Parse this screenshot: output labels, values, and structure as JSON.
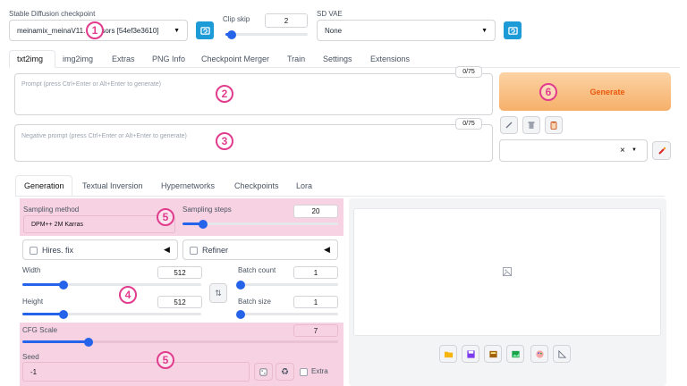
{
  "top": {
    "checkpoint_label": "Stable Diffusion checkpoint",
    "checkpoint_value": "meinamix_meinaV11.",
    "checkpoint_suffix": "sors [54ef3e3610]",
    "clip_skip_label": "Clip skip",
    "clip_skip_value": "2",
    "clip_skip_fraction": 0.08,
    "vae_label": "SD VAE",
    "vae_value": "None"
  },
  "main_tabs": [
    "txt2img",
    "img2img",
    "Extras",
    "PNG Info",
    "Checkpoint Merger",
    "Train",
    "Settings",
    "Extensions"
  ],
  "prompt": {
    "placeholder": "Prompt (press Ctrl+Enter or Alt+Enter to generate)",
    "counter": "0/75"
  },
  "negative_prompt": {
    "placeholder": "Negative prompt (press Ctrl+Enter or Alt+Enter to generate)",
    "counter": "0/75"
  },
  "generate_label": "Generate",
  "style_clear": "×",
  "sub_tabs": [
    "Generation",
    "Textual Inversion",
    "Hypernetworks",
    "Checkpoints",
    "Lora"
  ],
  "sampling": {
    "method_label": "Sampling method",
    "method_value": "DPM++ 2M Karras",
    "steps_label": "Sampling steps",
    "steps_value": "20",
    "steps_fraction": 0.13
  },
  "hires_label": "Hires. fix",
  "refiner_label": "Refiner",
  "width": {
    "label": "Width",
    "value": "512",
    "fraction": 0.23
  },
  "height": {
    "label": "Height",
    "value": "512",
    "fraction": 0.23
  },
  "batch_count": {
    "label": "Batch count",
    "value": "1",
    "fraction": 0.0
  },
  "batch_size": {
    "label": "Batch size",
    "value": "1",
    "fraction": 0.0
  },
  "cfg": {
    "label": "CFG Scale",
    "value": "7",
    "fraction": 0.21
  },
  "seed": {
    "label": "Seed",
    "value": "-1",
    "extra_label": "Extra"
  },
  "annotations": [
    "1",
    "2",
    "3",
    "4",
    "5",
    "6"
  ],
  "colors": {
    "accent": "#2563eb",
    "highlight": "#f7d2e2",
    "marker": "#e13c8d",
    "generate": "#f8b878",
    "generate_text": "#ea580c"
  }
}
